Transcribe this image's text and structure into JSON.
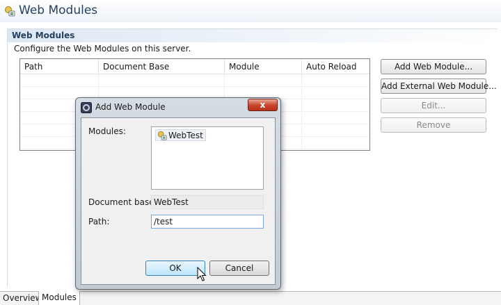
{
  "editor": {
    "title": "Web Modules"
  },
  "section": {
    "title": "Web Modules",
    "description": "Configure the Web Modules on this server."
  },
  "table": {
    "columns": [
      "Path",
      "Document Base",
      "Module",
      "Auto Reload"
    ],
    "rows": []
  },
  "buttons": {
    "add_web_module": "Add Web Module...",
    "add_external_web_module": "Add External Web Module...",
    "edit": "Edit...",
    "remove": "Remove"
  },
  "tabs": [
    {
      "label": "Overview",
      "active": false
    },
    {
      "label": "Modules",
      "active": true
    }
  ],
  "dialog": {
    "title": "Add Web Module",
    "close_label": "x",
    "modules_label": "Modules:",
    "modules": [
      "WebTest"
    ],
    "document_base_label": "Document base:",
    "document_base_value": "WebTest",
    "path_label": "Path:",
    "path_value": "/test",
    "ok_label": "OK",
    "cancel_label": "Cancel"
  },
  "colors": {
    "section_title": "#26415f",
    "close_button": "#c8432a",
    "ok_button_border": "#3c7fb1"
  },
  "icons": {
    "editor": "web-module-icon",
    "dialog": "eclipse-icon",
    "module": "web-module-icon",
    "close": "close-icon",
    "cursor": "mouse-pointer-icon"
  }
}
